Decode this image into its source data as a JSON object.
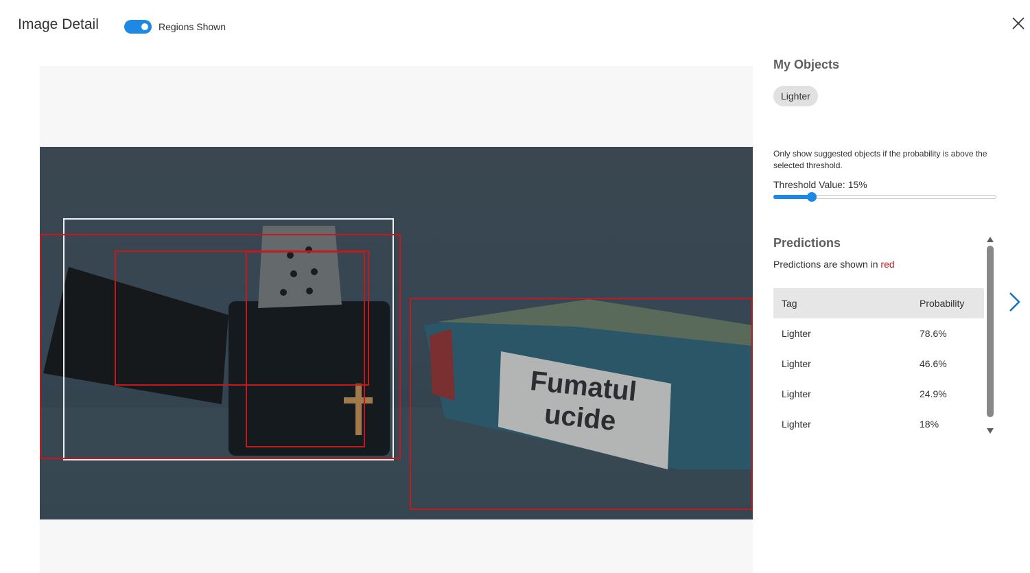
{
  "header": {
    "title": "Image Detail",
    "toggle_label": "Regions Shown",
    "toggle_on": true,
    "close_icon": "close-icon"
  },
  "image": {
    "printed_text": [
      "Fumatul",
      "ucide"
    ],
    "regions": [
      {
        "kind": "own object",
        "color": "#f0f0f0"
      },
      {
        "kind": "prediction",
        "color": "#c8161d"
      },
      {
        "kind": "prediction",
        "color": "#c8161d"
      },
      {
        "kind": "prediction",
        "color": "#c8161d"
      },
      {
        "kind": "prediction",
        "color": "#c8161d"
      }
    ]
  },
  "objects": {
    "heading": "My Objects",
    "tags": [
      "Lighter"
    ]
  },
  "threshold": {
    "hint": "Only show suggested objects if the probability is above the selected threshold.",
    "label": "Threshold Value: 15%",
    "value_percent": 15,
    "accent": "#1e88e5"
  },
  "predictions": {
    "heading": "Predictions",
    "note_prefix": "Predictions are shown in ",
    "note_color_word": "red",
    "columns": [
      "Tag",
      "Probability"
    ],
    "rows": [
      {
        "tag": "Lighter",
        "probability": "78.6%"
      },
      {
        "tag": "Lighter",
        "probability": "46.6%"
      },
      {
        "tag": "Lighter",
        "probability": "24.9%"
      },
      {
        "tag": "Lighter",
        "probability": "18%"
      }
    ],
    "highlight_color": "#c8161d"
  },
  "navigation": {
    "next_icon": "chevron-right-icon",
    "scroll_up_icon": "triangle-up-icon",
    "scroll_down_icon": "triangle-down-icon"
  }
}
